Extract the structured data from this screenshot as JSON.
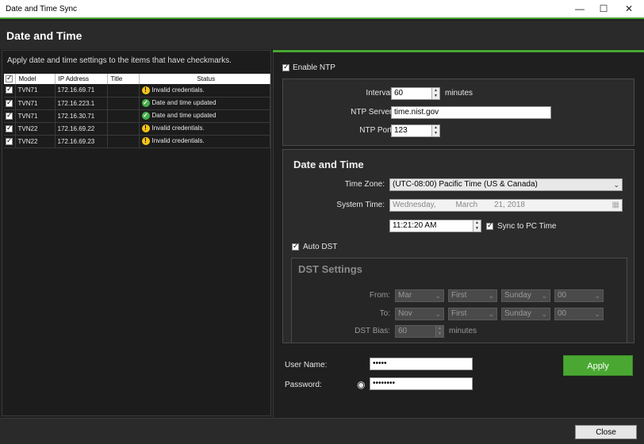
{
  "window": {
    "title": "Date and Time Sync",
    "minimize": "—",
    "maximize": "☐",
    "close": "✕"
  },
  "header": {
    "title": "Date and Time"
  },
  "left": {
    "instruction": "Apply date and time settings to the items that have checkmarks.",
    "columns": [
      "Model",
      "IP Address",
      "Title",
      "Status"
    ],
    "rows": [
      {
        "model": "TVN71",
        "ip": "172.16.69.71",
        "title": "",
        "status": "Invalid credentials.",
        "state": "warn"
      },
      {
        "model": "TVN71",
        "ip": "172.16.223.1",
        "title": "",
        "status": "Date and time updated",
        "state": "ok"
      },
      {
        "model": "TVN71",
        "ip": "172.16.30.71",
        "title": "",
        "status": "Date and time updated",
        "state": "ok"
      },
      {
        "model": "TVN22",
        "ip": "172.16.69.22",
        "title": "",
        "status": "Invalid credentials.",
        "state": "warn"
      },
      {
        "model": "TVN22",
        "ip": "172.16.69.23",
        "title": "",
        "status": "Invalid credentials.",
        "state": "warn"
      }
    ]
  },
  "ntp": {
    "enable_label": "Enable NTP",
    "interval_label": "Interval:",
    "interval_value": "60",
    "interval_unit": "minutes",
    "server_label": "NTP Server:",
    "server_value": "time.nist.gov",
    "port_label": "NTP Port:",
    "port_value": "123"
  },
  "datetime": {
    "title": "Date and Time",
    "timezone_label": "Time Zone:",
    "timezone_value": "(UTC-08:00) Pacific Time (US & Canada)",
    "systime_label": "System Time:",
    "date_weekday": "Wednesday,",
    "date_month": "March",
    "date_day": "21, 2018",
    "time_value": "11:21:20 AM",
    "sync_label": "Sync to PC Time",
    "auto_dst_label": "Auto DST"
  },
  "dst": {
    "title": "DST Settings",
    "from_label": "From:",
    "to_label": "To:",
    "bias_label": "DST Bias:",
    "from": {
      "month": "Mar",
      "week": "First",
      "day": "Sunday",
      "hour": "00"
    },
    "to": {
      "month": "Nov",
      "week": "First",
      "day": "Sunday",
      "hour": "00"
    },
    "bias_value": "60",
    "bias_unit": "minutes"
  },
  "credentials": {
    "user_label": "User Name:",
    "user_value": "•••••",
    "password_label": "Password:",
    "password_value": "••••••••"
  },
  "actions": {
    "apply": "Apply",
    "close": "Close"
  },
  "icons": {
    "warn": "!",
    "ok": "✓",
    "eye": "◉",
    "dropdown": "⌄"
  }
}
